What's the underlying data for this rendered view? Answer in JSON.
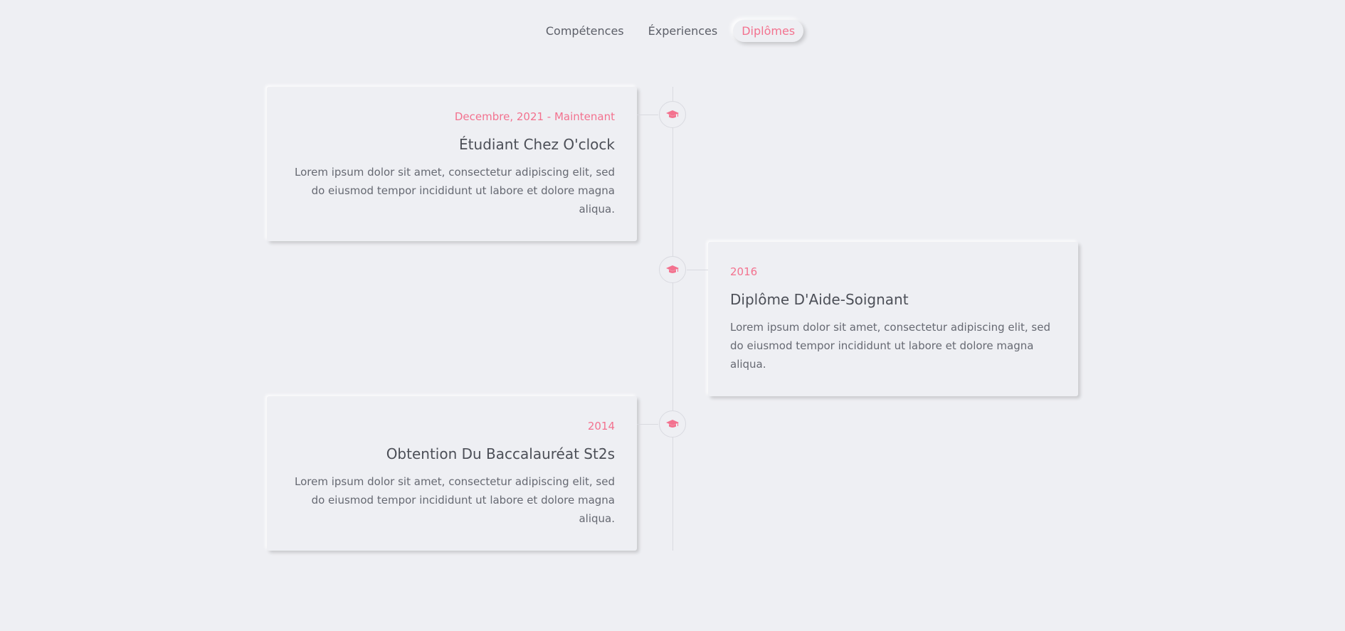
{
  "tabs": [
    {
      "label": "Compétences",
      "active": false
    },
    {
      "label": "Éxperiences",
      "active": false
    },
    {
      "label": "Diplômes",
      "active": true
    }
  ],
  "timeline": {
    "node_icon": "graduation-cap-icon",
    "accent_color": "#f3728f",
    "items": [
      {
        "side": "left",
        "date": "Decembre, 2021 - Maintenant",
        "title": "Étudiant Chez O'clock",
        "description": "Lorem ipsum dolor sit amet, consectetur adipiscing elit, sed do eiusmod tempor incididunt ut labore et dolore magna aliqua."
      },
      {
        "side": "right",
        "date": "2016",
        "title": "Diplôme D'Aide-Soignant",
        "description": "Lorem ipsum dolor sit amet, consectetur adipiscing elit, sed do eiusmod tempor incididunt ut labore et dolore magna aliqua."
      },
      {
        "side": "left",
        "date": "2014",
        "title": "Obtention Du Baccalauréat St2s",
        "description": "Lorem ipsum dolor sit amet, consectetur adipiscing elit, sed do eiusmod tempor incididunt ut labore et dolore magna aliqua."
      }
    ]
  }
}
